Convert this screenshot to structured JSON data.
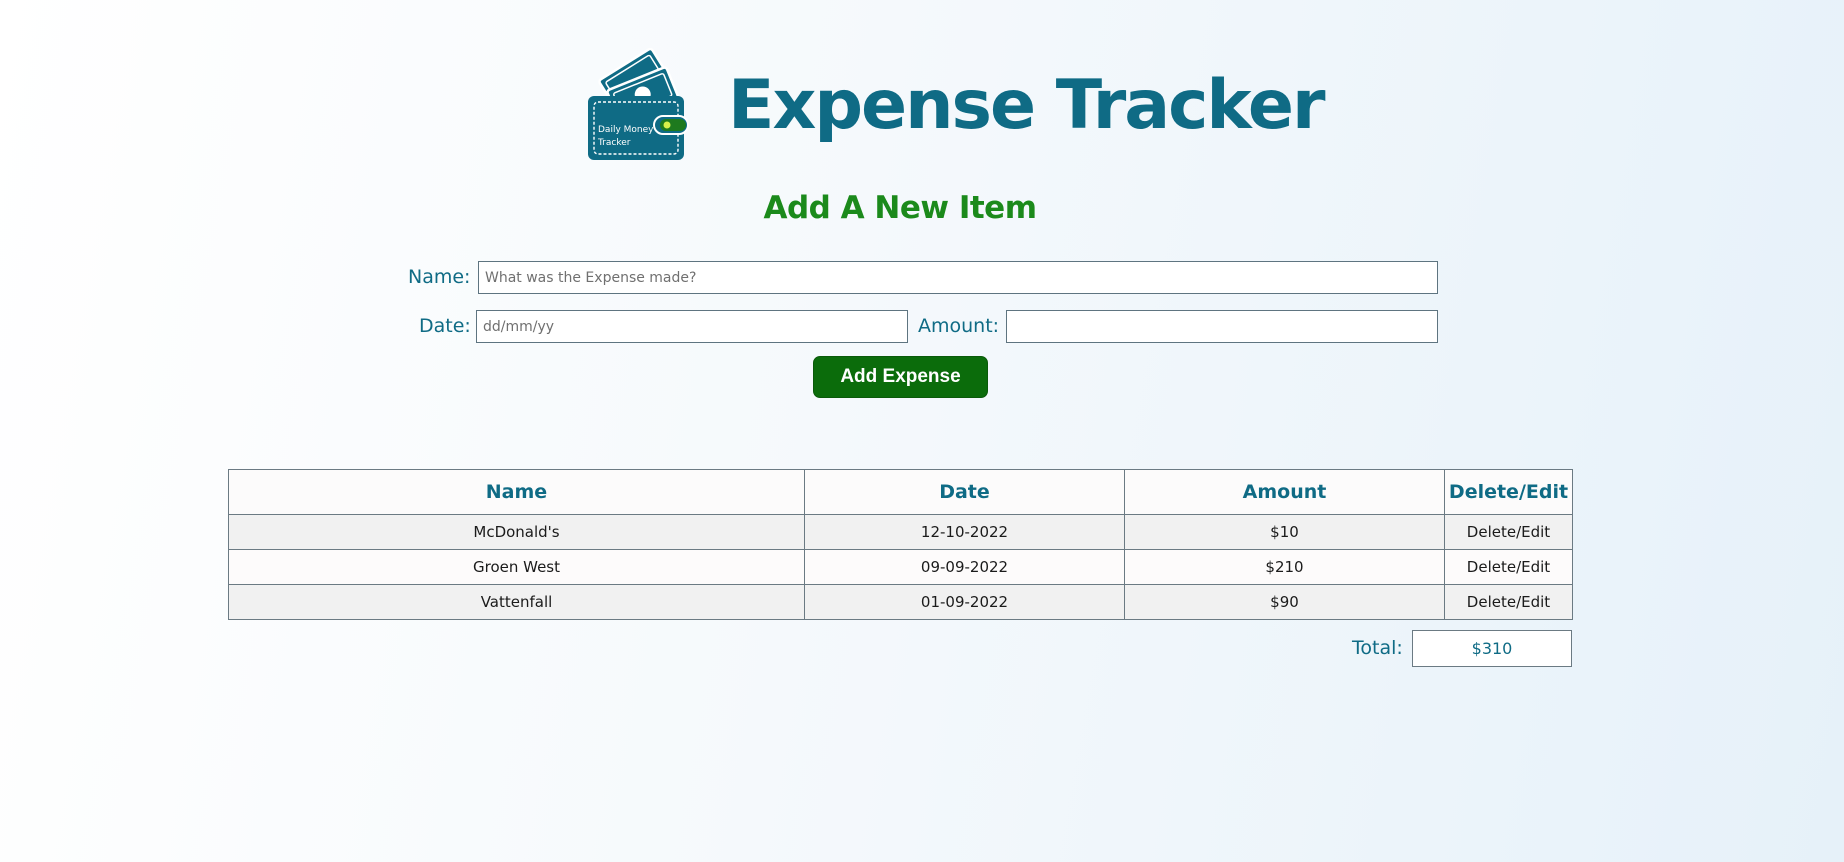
{
  "header": {
    "title": "Expense Tracker",
    "logo_icon": "wallet-money-icon",
    "logo_text_line1": "Daily Money",
    "logo_text_line2": "Tracker"
  },
  "form": {
    "heading": "Add A New Item",
    "name_label": "Name:",
    "name_placeholder": "What was the Expense made?",
    "name_value": "",
    "date_label": "Date:",
    "date_placeholder": "dd/mm/yy",
    "date_value": "",
    "amount_label": "Amount:",
    "amount_placeholder": "",
    "amount_value": "",
    "submit_label": "Add Expense"
  },
  "table": {
    "columns": [
      "Name",
      "Date",
      "Amount",
      "Delete/Edit"
    ],
    "rows": [
      {
        "name": "McDonald's",
        "date": "12-10-2022",
        "amount": "$10",
        "action": "Delete/Edit"
      },
      {
        "name": "Groen West",
        "date": "09-09-2022",
        "amount": "$210",
        "action": "Delete/Edit"
      },
      {
        "name": "Vattenfall",
        "date": "01-09-2022",
        "amount": "$90",
        "action": "Delete/Edit"
      }
    ]
  },
  "summary": {
    "total_label": "Total:",
    "total_value": "$310"
  },
  "colors": {
    "brand_teal": "#0f6b85",
    "heading_green": "#1b8a1b",
    "button_green": "#0b6c0b"
  }
}
